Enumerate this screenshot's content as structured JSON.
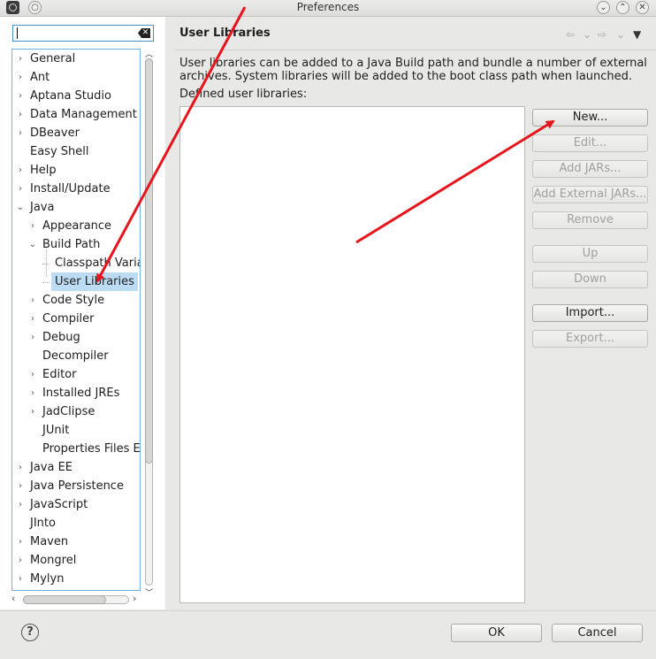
{
  "window": {
    "title": "Preferences"
  },
  "filter": {
    "value": "",
    "clear_icon": "clear-icon"
  },
  "tree": {
    "items": [
      {
        "label": "General",
        "level": 0,
        "expander": "collapsed"
      },
      {
        "label": "Ant",
        "level": 0,
        "expander": "collapsed"
      },
      {
        "label": "Aptana Studio",
        "level": 0,
        "expander": "collapsed"
      },
      {
        "label": "Data Management",
        "level": 0,
        "expander": "collapsed"
      },
      {
        "label": "DBeaver",
        "level": 0,
        "expander": "collapsed"
      },
      {
        "label": "Easy Shell",
        "level": 0,
        "expander": "none"
      },
      {
        "label": "Help",
        "level": 0,
        "expander": "collapsed"
      },
      {
        "label": "Install/Update",
        "level": 0,
        "expander": "collapsed"
      },
      {
        "label": "Java",
        "level": 0,
        "expander": "expanded"
      },
      {
        "label": "Appearance",
        "level": 1,
        "expander": "collapsed"
      },
      {
        "label": "Build Path",
        "level": 1,
        "expander": "expanded"
      },
      {
        "label": "Classpath Varia",
        "level": 2,
        "expander": "none"
      },
      {
        "label": "User Libraries",
        "level": 2,
        "expander": "none",
        "selected": true
      },
      {
        "label": "Code Style",
        "level": 1,
        "expander": "collapsed"
      },
      {
        "label": "Compiler",
        "level": 1,
        "expander": "collapsed"
      },
      {
        "label": "Debug",
        "level": 1,
        "expander": "collapsed"
      },
      {
        "label": "Decompiler",
        "level": 1,
        "expander": "none"
      },
      {
        "label": "Editor",
        "level": 1,
        "expander": "collapsed"
      },
      {
        "label": "Installed JREs",
        "level": 1,
        "expander": "collapsed"
      },
      {
        "label": "JadClipse",
        "level": 1,
        "expander": "collapsed"
      },
      {
        "label": "JUnit",
        "level": 1,
        "expander": "none"
      },
      {
        "label": "Properties Files Ec",
        "level": 1,
        "expander": "none"
      },
      {
        "label": "Java EE",
        "level": 0,
        "expander": "collapsed"
      },
      {
        "label": "Java Persistence",
        "level": 0,
        "expander": "collapsed"
      },
      {
        "label": "JavaScript",
        "level": 0,
        "expander": "collapsed"
      },
      {
        "label": "JInto",
        "level": 0,
        "expander": "none"
      },
      {
        "label": "Maven",
        "level": 0,
        "expander": "collapsed"
      },
      {
        "label": "Mongrel",
        "level": 0,
        "expander": "collapsed"
      },
      {
        "label": "Mylyn",
        "level": 0,
        "expander": "collapsed"
      }
    ]
  },
  "page": {
    "title": "User Libraries",
    "description": "User libraries can be added to a Java Build path and bundle a number of external archives. System libraries will be added to the boot class path when launched.",
    "list_label": "Defined user libraries:",
    "nav_icons": [
      "back-icon",
      "back-menu-icon",
      "forward-icon",
      "forward-menu-icon",
      "view-menu-icon"
    ]
  },
  "buttons": {
    "new": "New...",
    "edit": "Edit...",
    "add_jars": "Add JARs...",
    "add_external_jars": "Add External JARs...",
    "remove": "Remove",
    "up": "Up",
    "down": "Down",
    "import": "Import...",
    "export": "Export..."
  },
  "dialog": {
    "ok": "OK",
    "cancel": "Cancel",
    "help_icon": "help-icon"
  },
  "colors": {
    "selection": "#bcdcf4",
    "focus_border": "#6fb1e1",
    "annotation_arrow": "#e8141b",
    "disabled_text": "#a0a0a0"
  }
}
